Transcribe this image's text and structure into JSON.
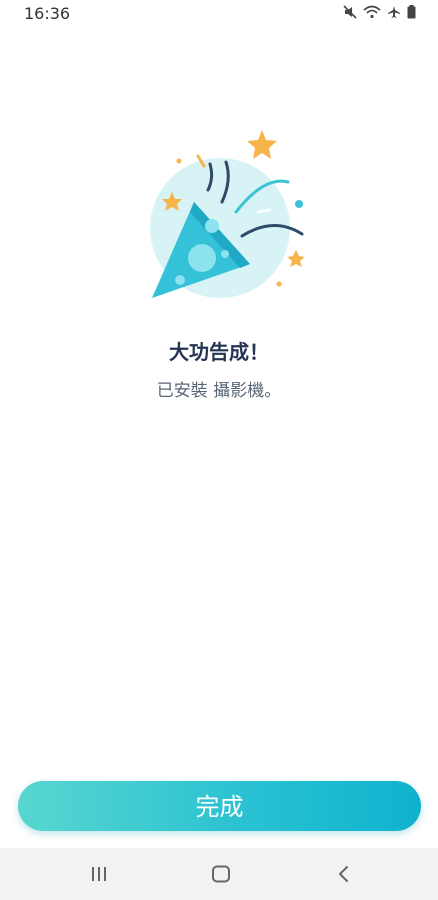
{
  "status_bar": {
    "time": "16:36",
    "icons": [
      "mute-icon",
      "wifi-icon",
      "airplane-icon",
      "battery-icon"
    ]
  },
  "illustration": {
    "icon": "party-popper-icon",
    "colors": {
      "circle": "#d7f3f5",
      "cone": "#35c1d8",
      "dots": "#8ce2ee",
      "stars": "#f6b44b",
      "streamer_dark": "#2e4a6b",
      "streamer_teal": "#3cc3d5"
    }
  },
  "message": {
    "title": "大功告成！",
    "subtitle": "已安裝 攝影機。"
  },
  "done_button": {
    "label": "完成"
  },
  "nav_bar": {
    "icons": [
      "recent-apps-icon",
      "home-icon",
      "back-icon"
    ]
  },
  "colors": {
    "accent_start": "#58d6cf",
    "accent_end": "#0fb2cf",
    "title": "#243452",
    "subtitle": "#5a6676"
  }
}
